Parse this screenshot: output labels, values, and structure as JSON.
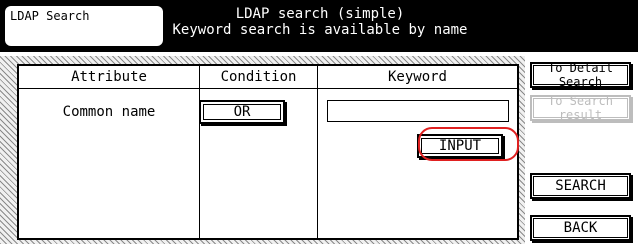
{
  "header": {
    "title": "LDAP Search",
    "message_line1": "LDAP search (simple)",
    "message_line2": "Keyword search is available by name"
  },
  "table": {
    "columns": [
      "Attribute",
      "Condition",
      "Keyword"
    ],
    "row": {
      "attribute": "Common name",
      "condition_button": "OR",
      "keyword_value": "",
      "input_button": "INPUT"
    }
  },
  "side_buttons": {
    "detail_search": "To Detail Search",
    "search_result": "To Search result",
    "search": "SEARCH",
    "back": "BACK"
  },
  "colors": {
    "header_bg": "#000000",
    "highlight": "#e02020",
    "disabled_text": "#bdbdbd"
  }
}
